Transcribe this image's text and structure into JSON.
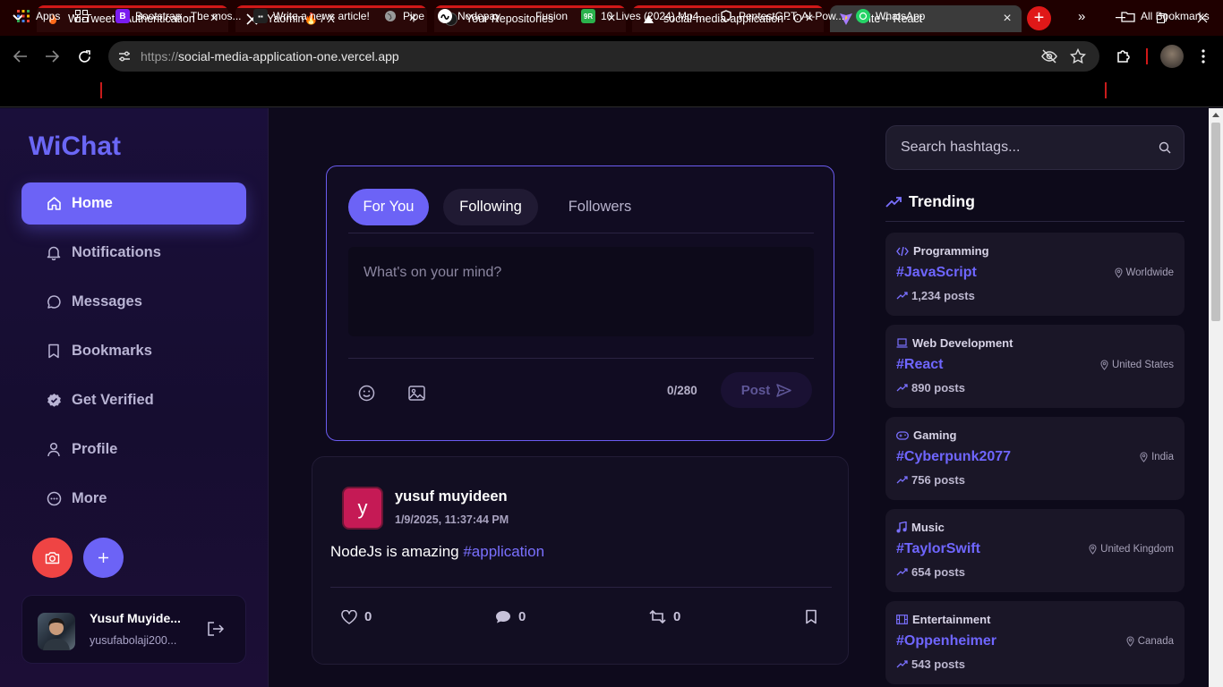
{
  "browser": {
    "tabs": [
      {
        "title": "Wi-Tweet - Authentication -",
        "favicon": "flame-icon"
      },
      {
        "title": "Yaomin🔥 / X",
        "favicon": "x-logo-icon"
      },
      {
        "title": "Your Repositories",
        "favicon": "github-icon"
      },
      {
        "title": "social-media-application - O",
        "favicon": "vercel-icon"
      },
      {
        "title": "Vite + React",
        "favicon": "vite-icon"
      }
    ],
    "url_protocol": "https://",
    "url_host": "social-media-application-one.vercel.app",
    "bookmarks": [
      {
        "label": "Apps"
      },
      {
        "label": "Bootstrap · The mos..."
      },
      {
        "label": "Write a news article!"
      },
      {
        "label": "Pipe"
      },
      {
        "label": "Nodepay"
      },
      {
        "label": "Fusion"
      },
      {
        "label": "10 Lives (2024) Mp4..."
      },
      {
        "label": "PentestGPT: AI-Pow..."
      },
      {
        "label": "WhatsApp"
      }
    ],
    "all_bookmarks": "All Bookmarks",
    "accent_color": "#d01818"
  },
  "sidebar": {
    "logo": "WiChat",
    "items": [
      {
        "label": "Home",
        "icon": "home-icon"
      },
      {
        "label": "Notifications",
        "icon": "bell-icon"
      },
      {
        "label": "Messages",
        "icon": "chat-bubble-icon"
      },
      {
        "label": "Bookmarks",
        "icon": "bookmark-icon"
      },
      {
        "label": "Get Verified",
        "icon": "verified-badge-icon"
      },
      {
        "label": "Profile",
        "icon": "user-icon"
      },
      {
        "label": "More",
        "icon": "more-circle-icon"
      }
    ],
    "user": {
      "name": "Yusuf Muyide...",
      "email": "yusufabolaji200..."
    },
    "accent_color": "#6c63f6"
  },
  "composer": {
    "tabs": [
      "For You",
      "Following",
      "Followers"
    ],
    "placeholder": "What's on your mind?",
    "counter": "0/280",
    "post_label": "Post"
  },
  "post": {
    "avatar_letter": "y",
    "author": "yusuf muyideen",
    "date": "1/9/2025, 11:37:44 PM",
    "text": "NodeJs is amazing ",
    "hashtag": "#application",
    "likes": "0",
    "comments": "0",
    "reposts": "0"
  },
  "rightbar": {
    "search_placeholder": "Search hashtags...",
    "trending_title": "Trending",
    "trends": [
      {
        "category": "Programming",
        "icon": "code-icon",
        "tag": "#JavaScript",
        "location": "Worldwide",
        "posts": "1,234 posts"
      },
      {
        "category": "Web Development",
        "icon": "laptop-icon",
        "tag": "#React",
        "location": "United States",
        "posts": "890 posts"
      },
      {
        "category": "Gaming",
        "icon": "gamepad-icon",
        "tag": "#Cyberpunk2077",
        "location": "India",
        "posts": "756 posts"
      },
      {
        "category": "Music",
        "icon": "music-note-icon",
        "tag": "#TaylorSwift",
        "location": "United Kingdom",
        "posts": "654 posts"
      },
      {
        "category": "Entertainment",
        "icon": "film-icon",
        "tag": "#Oppenheimer",
        "location": "Canada",
        "posts": "543 posts"
      }
    ]
  }
}
